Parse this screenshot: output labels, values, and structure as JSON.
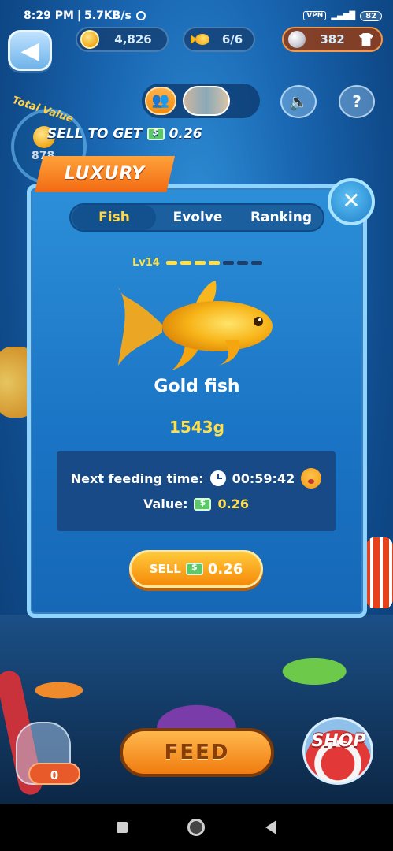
{
  "status_bar": {
    "time": "8:29 PM",
    "speed": "5.7KB/s",
    "vpn": "VPN",
    "battery": "82"
  },
  "hud": {
    "coins": "4,826",
    "fish_count": "6/6",
    "pearls": "382"
  },
  "total_value": {
    "label": "Total Value",
    "value": "878"
  },
  "sell_to_get": {
    "label": "SELL TO GET",
    "amount": "0.26"
  },
  "banner": "LUXURY",
  "tabs": [
    {
      "label": "Fish",
      "active": true
    },
    {
      "label": "Evolve",
      "active": false
    },
    {
      "label": "Ranking",
      "active": false
    }
  ],
  "fish": {
    "level": "Lv14",
    "level_progress": 0.5,
    "name": "Gold fish",
    "weight": "1543g",
    "next_feeding_label": "Next feeding time:",
    "next_feeding_time": "00:59:42",
    "value_label": "Value:",
    "value": "0.26"
  },
  "sell_button": {
    "label": "SELL",
    "amount": "0.26"
  },
  "bottom": {
    "jar_count": "0",
    "feed_label": "FEED",
    "shop_label": "SHOP"
  },
  "colors": {
    "accent_gold": "#ffe04a",
    "button_orange": "#f58a0a",
    "modal_blue": "#1a73c4"
  }
}
